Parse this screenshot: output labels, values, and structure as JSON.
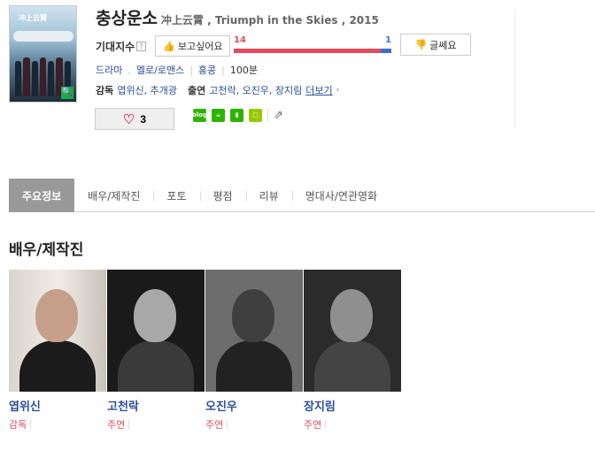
{
  "movie": {
    "title_ko": "충상운소",
    "title_original": "冲上云霄 , Triumph in the Skies , 2015",
    "poster_logo": "冲上云霄"
  },
  "expectation": {
    "label": "기대지수",
    "help": "?",
    "want_label": "보고싶어요",
    "dont_label": "글쎄요",
    "want_count": "14",
    "dont_count": "1",
    "want_fraction": 0.93,
    "colors": {
      "want": "#e24b60",
      "dont": "#3a70d6"
    }
  },
  "meta": {
    "genres": [
      "드라마",
      "멜로/로맨스"
    ],
    "country": "홍콩",
    "runtime": "100분"
  },
  "credits": {
    "director_label": "감독",
    "directors": "엽위신, 추개광",
    "cast_label": "출연",
    "cast": "고천락, 오진우, 장지림",
    "more": "더보기"
  },
  "like": {
    "count": "3"
  },
  "shares": {
    "blog": "blog"
  },
  "tabs": [
    {
      "label": "주요정보",
      "active": true
    },
    {
      "label": "배우/제작진"
    },
    {
      "label": "포토"
    },
    {
      "label": "평점"
    },
    {
      "label": "리뷰"
    },
    {
      "label": "명대사/연관영화"
    }
  ],
  "section": {
    "title": "배우/제작진"
  },
  "people": [
    {
      "name": "엽위신",
      "role": "감독"
    },
    {
      "name": "고천락",
      "role": "주연"
    },
    {
      "name": "오진우",
      "role": "주연"
    },
    {
      "name": "장지림",
      "role": "주연"
    }
  ]
}
